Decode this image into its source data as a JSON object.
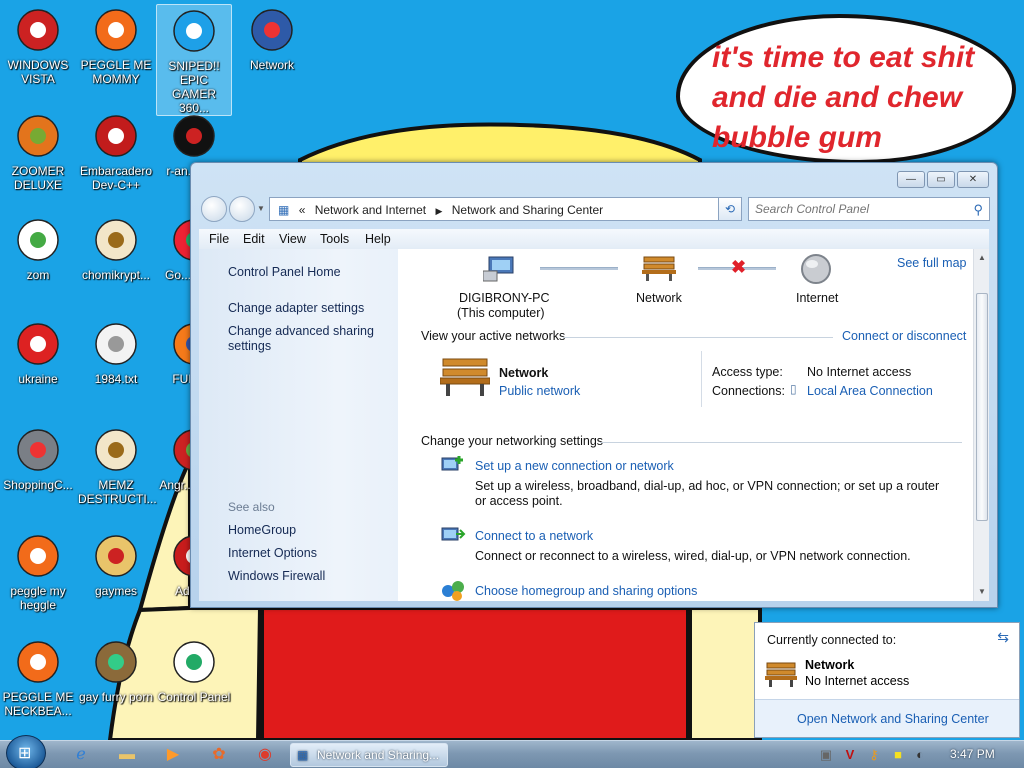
{
  "wallpaper": {
    "speech_text": "it's time to eat shit and die and chew bubble gum",
    "colors": {
      "sky": "#1aa3e6",
      "red": "#e01b1b",
      "yellow": "#fff06a",
      "skin": "#fdf4b8"
    }
  },
  "desktop_icons": [
    {
      "label": "WINDOWS VISTA",
      "icon": "vista-disc-icon"
    },
    {
      "label": "PEGGLE ME MOMMY",
      "icon": "peggle-icon"
    },
    {
      "label": "SNIPED!! EPIC GAMER 360...",
      "icon": "skype-icon"
    },
    {
      "label": "Network",
      "icon": "network-globe-icon"
    },
    {
      "label": "ZOOMER DELUXE",
      "icon": "zoomer-icon"
    },
    {
      "label": "Embarcadero Dev-C++",
      "icon": "devcpp-icon"
    },
    {
      "label": "r-an... part",
      "icon": "dark-disc-icon"
    },
    {
      "label": "zom",
      "icon": "flower-icon"
    },
    {
      "label": "chomikrypt...",
      "icon": "hourglass-shortcut-icon"
    },
    {
      "label": "Go... Chr...",
      "icon": "chrome-icon"
    },
    {
      "label": "ukraine",
      "icon": "radiation-icon"
    },
    {
      "label": "1984.txt",
      "icon": "text-file-icon"
    },
    {
      "label": "FURR...",
      "icon": "firefox-icon"
    },
    {
      "label": "ShoppingC...",
      "icon": "flash-icon"
    },
    {
      "label": "MEMZ DESTRUCTI...",
      "icon": "hourglass-shortcut-icon"
    },
    {
      "label": "Angr... Sea...",
      "icon": "angry-birds-icon"
    },
    {
      "label": "peggle my heggle",
      "icon": "peggle-icon"
    },
    {
      "label": "gaymes",
      "icon": "folder-icon"
    },
    {
      "label": "Adob...",
      "icon": "adobe-icon"
    },
    {
      "label": "PEGGLE ME NECKBEA...",
      "icon": "peggle-icon"
    },
    {
      "label": "gay furry porn",
      "icon": "box-beaver-icon"
    },
    {
      "label": "Control Panel",
      "icon": "control-panel-icon"
    }
  ],
  "window": {
    "title_buttons": {
      "minimize": "—",
      "maximize": "▭",
      "close": "✕"
    },
    "breadcrumb": [
      "Network and Internet",
      "Network and Sharing Center"
    ],
    "breadcrumb_prefix": "«",
    "search_placeholder": "Search Control Panel",
    "menu": [
      "File",
      "Edit",
      "View",
      "Tools",
      "Help"
    ],
    "left_pane": {
      "home": "Control Panel Home",
      "tasks": [
        "Change adapter settings",
        "Change advanced sharing settings"
      ],
      "see_also_heading": "See also",
      "see_also": [
        "HomeGroup",
        "Internet Options",
        "Windows Firewall"
      ]
    },
    "map": {
      "see_full_map": "See full map",
      "computer_name": "DIGIBRONY-PC",
      "computer_sub": "(This computer)",
      "network_label": "Network",
      "internet_label": "Internet"
    },
    "active_networks": {
      "heading": "View your active networks",
      "connect_link": "Connect or disconnect",
      "network_name": "Network",
      "network_type": "Public network",
      "access_type_label": "Access type:",
      "access_type_value": "No Internet access",
      "connections_label": "Connections:",
      "connections_value": "Local Area Connection"
    },
    "settings": {
      "heading": "Change your networking settings",
      "items": [
        {
          "title": "Set up a new connection or network",
          "desc": "Set up a wireless, broadband, dial-up, ad hoc, or VPN connection; or set up a router or access point."
        },
        {
          "title": "Connect to a network",
          "desc": "Connect or reconnect to a wireless, wired, dial-up, or VPN network connection."
        },
        {
          "title": "Choose homegroup and sharing options",
          "desc": ""
        }
      ]
    }
  },
  "popup": {
    "heading": "Currently connected to:",
    "network_name": "Network",
    "status": "No Internet access",
    "footer_link": "Open Network and Sharing Center"
  },
  "taskbar": {
    "task_label": "Network and Sharing...",
    "clock": "3:47 PM",
    "pinned": [
      "ie-icon",
      "explorer-folder-icon",
      "media-player-icon",
      "app-icon",
      "chrome-icon"
    ]
  }
}
